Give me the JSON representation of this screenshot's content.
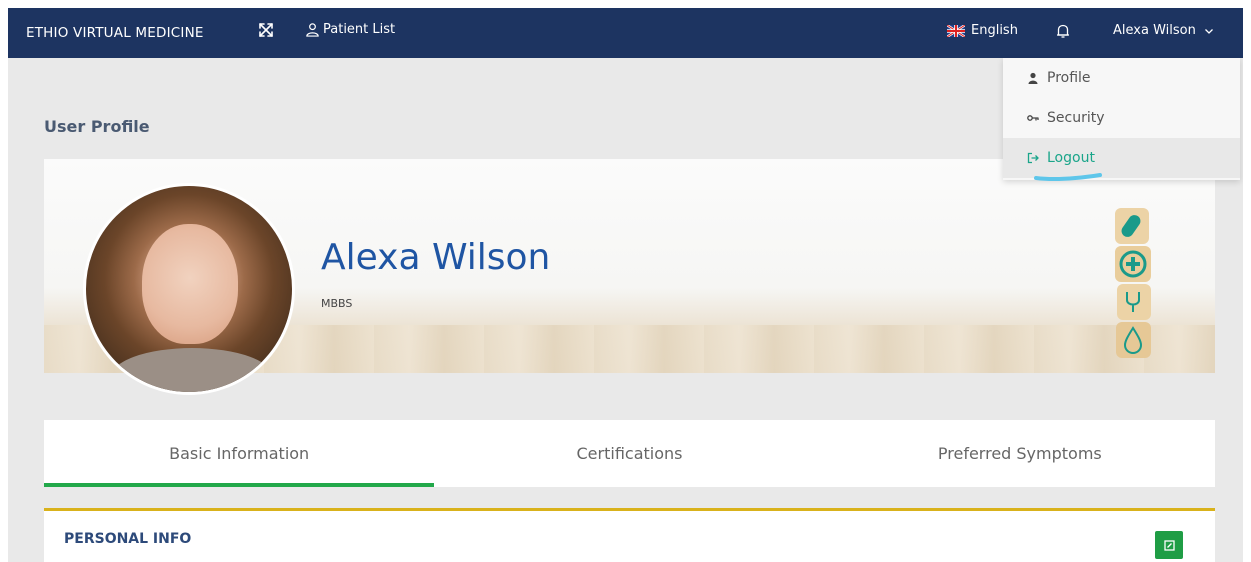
{
  "topbar": {
    "brand": "ETHIO VIRTUAL MEDICINE",
    "patient_list_label": "Patient List",
    "language_label": "English",
    "user_name": "Alexa Wilson",
    "bg_color": "#1d3461"
  },
  "dropdown": {
    "items": [
      {
        "label": "Profile",
        "icon": "user-icon"
      },
      {
        "label": "Security",
        "icon": "key-icon"
      },
      {
        "label": "Logout",
        "icon": "logout-icon",
        "active": true
      }
    ]
  },
  "page": {
    "title": "User Profile"
  },
  "profile": {
    "name": "Alexa Wilson",
    "degree": "MBBS"
  },
  "tabs": [
    {
      "label": "Basic Information",
      "active": true
    },
    {
      "label": "Certifications",
      "active": false
    },
    {
      "label": "Preferred Symptoms",
      "active": false
    }
  ],
  "card": {
    "title": "PERSONAL INFO",
    "accent_color": "#d9b21b",
    "edit_button_color": "#1f9d45"
  },
  "colors": {
    "active_tab_underline": "#22a84a",
    "name_color": "#1f55a3",
    "logout_color": "#1aa58a"
  }
}
